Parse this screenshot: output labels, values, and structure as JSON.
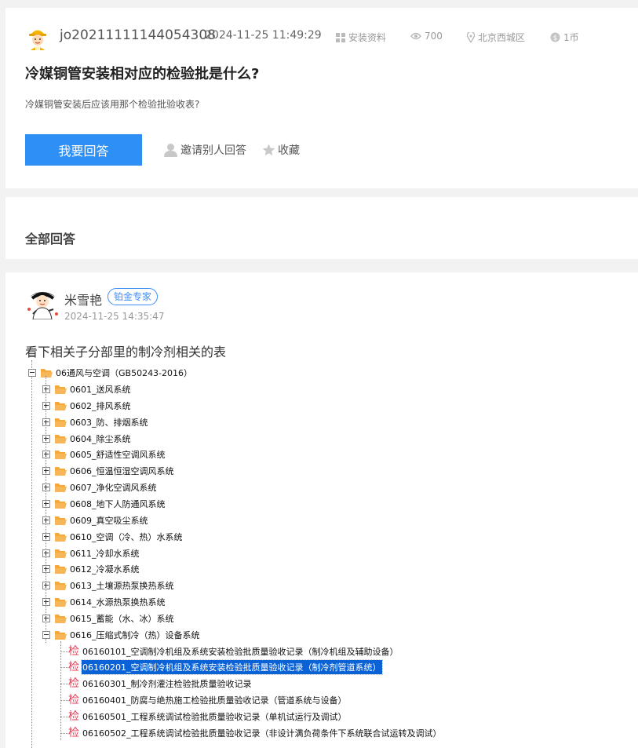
{
  "question": {
    "username": "jo20211111144054308",
    "time": "2024-11-25 11:49:29",
    "category": "安装资料",
    "views": "700",
    "location": "北京西城区",
    "reward": "1币",
    "title": "冷媒铜管安装相对应的检验批是什么?",
    "description": "冷媒铜管安装后应该用那个检验批验收表?",
    "answer_button": "我要回答",
    "invite_label": "邀请别人回答",
    "favorite_label": "收藏"
  },
  "all_answers_title": "全部回答",
  "answer": {
    "name": "米雪艳",
    "badge": "铂金专家",
    "time": "2024-11-25 14:35:47",
    "text": "看下相关子分部里的制冷剂相关的表"
  },
  "tree": {
    "root": "06通风与空调（GB50243-2016）",
    "children": [
      "0601_送风系统",
      "0602_排风系统",
      "0603_防、排烟系统",
      "0604_除尘系统",
      "0605_舒适性空调风系统",
      "0606_恒温恒湿空调风系统",
      "0607_净化空调风系统",
      "0608_地下人防通风系统",
      "0609_真空吸尘系统",
      "0610_空调（冷、热）水系统",
      "0611_冷却水系统",
      "0612_冷凝水系统",
      "0613_土壤源热泵换热系统",
      "0614_水源热泵换热系统",
      "0615_蓄能（水、冰）系统",
      "0616_压缩式制冷（热）设备系统"
    ],
    "leaf_marker": "检",
    "leaves": [
      "06160101_空调制冷机组及系统安装检验批质量验收记录（制冷机组及辅助设备）",
      "06160201_空调制冷机组及系统安装检验批质量验收记录（制冷剂管道系统）",
      "06160301_制冷剂灌注检验批质量验收记录",
      "06160401_防腐与绝热施工检验批质量验收记录（管道系统与设备）",
      "06160501_工程系统调试检验批质量验收记录（单机试运行及调试）",
      "06160502_工程系统调试检验批质量验收记录（非设计满负荷条件下系统联合试运转及调试）"
    ],
    "selected_leaf": "06160201_空调制冷机组及系统安装检验批质量验收记录（制冷剂管道系统）"
  },
  "colors": {
    "primary": "#2e90f5",
    "badge": "#3e8ef7",
    "selection": "#0a62d6",
    "leaf_marker": "#e83e5a",
    "folder": "#f6a93b"
  },
  "icons": {
    "category": "grid-icon",
    "views": "eye-icon",
    "location": "location-pin-icon",
    "reward": "coin-icon",
    "invite": "user-icon",
    "favorite": "star-icon"
  }
}
